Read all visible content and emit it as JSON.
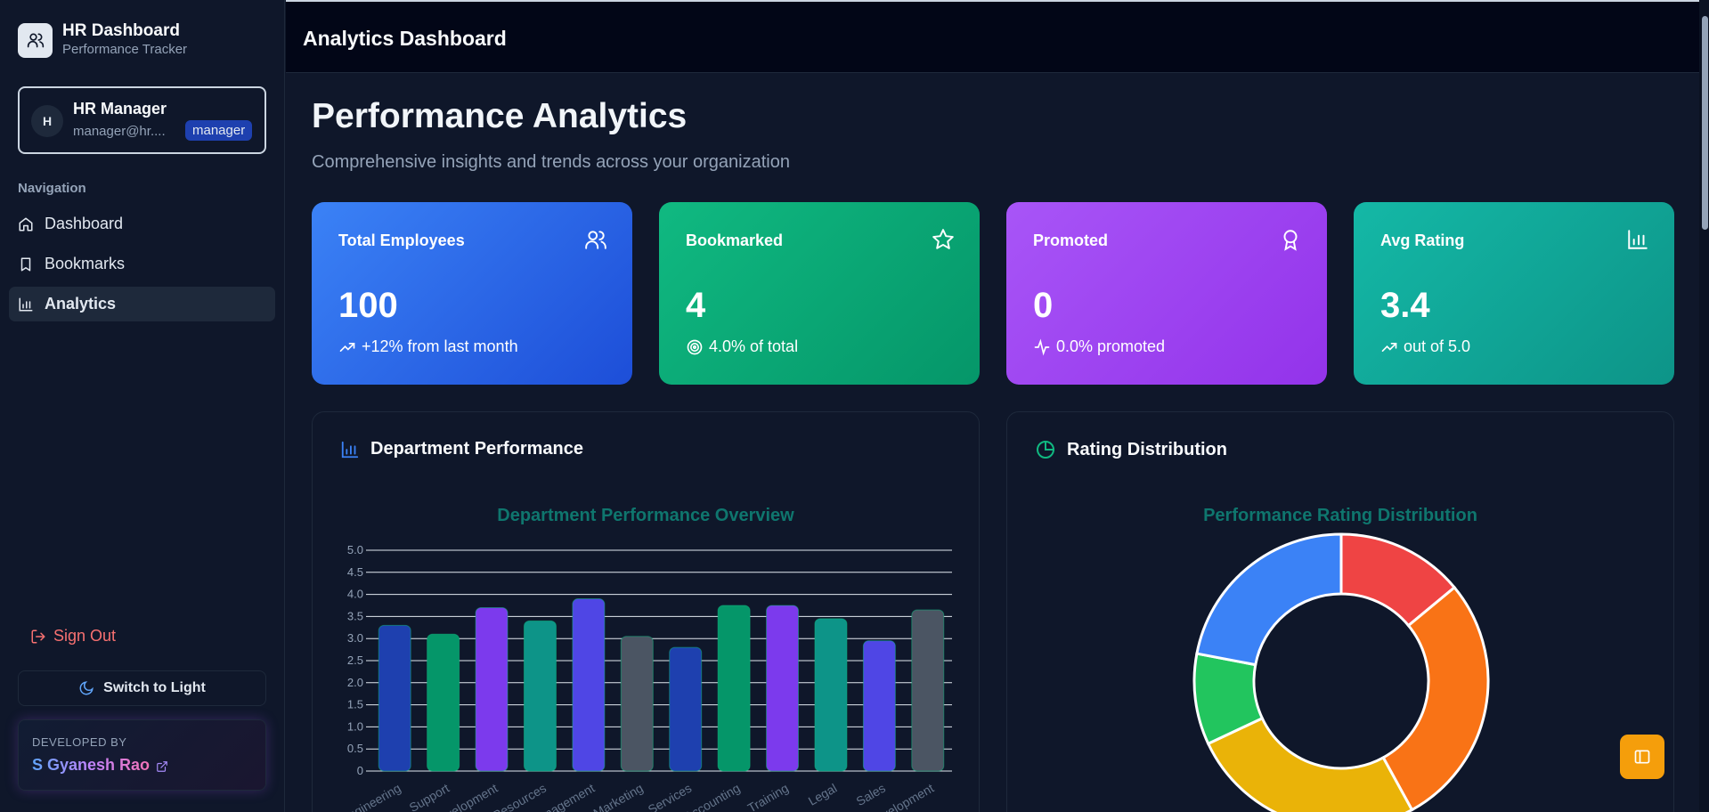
{
  "sidebar": {
    "brand_title": "HR Dashboard",
    "brand_subtitle": "Performance Tracker",
    "user": {
      "initial": "H",
      "name": "HR Manager",
      "email": "manager@hr....",
      "role": "manager"
    },
    "nav_label": "Navigation",
    "items": [
      {
        "label": "Dashboard",
        "icon": "home-icon",
        "active": false
      },
      {
        "label": "Bookmarks",
        "icon": "bookmark-icon",
        "active": false
      },
      {
        "label": "Analytics",
        "icon": "bar-chart-icon",
        "active": true
      }
    ],
    "sign_out": "Sign Out",
    "theme_toggle": "Switch to Light",
    "developed_by_label": "DEVELOPED BY",
    "developer": "S Gyanesh Rao"
  },
  "header": {
    "title": "Analytics Dashboard"
  },
  "main": {
    "title": "Performance Analytics",
    "subtitle": "Comprehensive insights and trends across your organization",
    "stats": [
      {
        "label": "Total Employees",
        "value": "100",
        "note": "+12% from last month",
        "icon": "users-icon",
        "note_icon": "trending-up-icon",
        "gradient": [
          "#3b82f6",
          "#1d4ed8"
        ]
      },
      {
        "label": "Bookmarked",
        "value": "4",
        "note": "4.0% of total",
        "icon": "star-icon",
        "note_icon": "target-icon",
        "gradient": [
          "#10b981",
          "#059669"
        ]
      },
      {
        "label": "Promoted",
        "value": "0",
        "note": "0.0% promoted",
        "icon": "award-icon",
        "note_icon": "activity-icon",
        "gradient": [
          "#a855f7",
          "#9333ea"
        ]
      },
      {
        "label": "Avg Rating",
        "value": "3.4",
        "note": "out of 5.0",
        "icon": "bar-chart-icon",
        "note_icon": "trending-up-icon",
        "gradient": [
          "#14b8a6",
          "#0d9488"
        ]
      }
    ],
    "dept_panel_title": "Department Performance",
    "rating_panel_title": "Rating Distribution"
  },
  "chart_data": [
    {
      "type": "bar",
      "title": "Department Performance Overview",
      "categories": [
        "Engineering",
        "Support",
        "Development",
        "Human Resources",
        "Management",
        "Marketing",
        "Services",
        "Accounting",
        "Training",
        "Legal",
        "Sales",
        "Development"
      ],
      "values": [
        3.3,
        3.1,
        3.7,
        3.4,
        3.9,
        3.05,
        2.8,
        3.75,
        3.75,
        3.45,
        2.95,
        3.65
      ],
      "colors": [
        "#1e40af",
        "#059669",
        "#7c3aed",
        "#0d9488",
        "#4f46e5",
        "#4b5563",
        "#1e40af",
        "#059669",
        "#7c3aed",
        "#0d9488",
        "#4f46e5",
        "#4b5563"
      ],
      "ylim": [
        0,
        5
      ],
      "yticks": [
        "0",
        "0.5",
        "1.0",
        "1.5",
        "2.0",
        "2.5",
        "3.0",
        "3.5",
        "4.0",
        "4.5",
        "5.0"
      ],
      "grid": true
    },
    {
      "type": "pie",
      "title": "Performance Rating Distribution",
      "values": [
        14,
        28,
        26,
        10,
        22
      ],
      "colors": [
        "#ef4444",
        "#f97316",
        "#eab308",
        "#22c55e",
        "#3b82f6"
      ]
    }
  ]
}
